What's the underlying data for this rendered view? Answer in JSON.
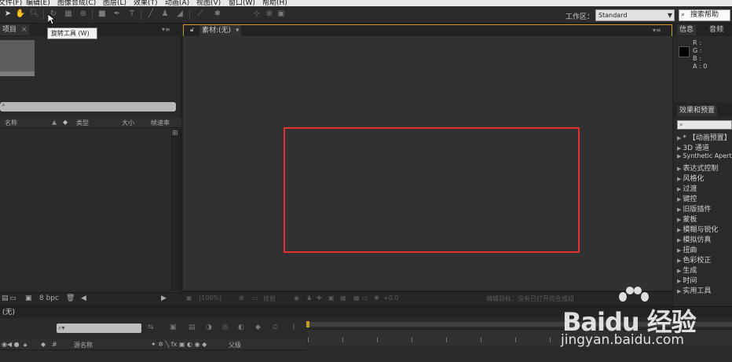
{
  "menubar": {
    "items": [
      "文件(F)",
      "编辑(E)",
      "图像合成(C)",
      "图层(L)",
      "效果(T)",
      "动画(A)",
      "视图(V)",
      "窗口(W)",
      "帮助(H)"
    ]
  },
  "toolbar": {
    "tools": [
      "selection-tool",
      "hand-tool",
      "zoom-tool",
      "rotation-tool",
      "camera-tool",
      "pan-behind-tool",
      "rectangle-tool",
      "pen-tool",
      "type-tool",
      "brush-tool",
      "clone-stamp-tool",
      "eraser-tool",
      "roto-brush-tool",
      "puppet-tool",
      "axis-tool"
    ],
    "workspace_label": "工作区：",
    "workspace_value": "Standard",
    "help_search_placeholder": "搜索帮助"
  },
  "tooltip": {
    "text": "旋转工具 (W)"
  },
  "project_panel": {
    "tab_label": "项目",
    "columns": [
      "名称",
      "类型",
      "大小",
      "帧速率"
    ],
    "footer_bpc": "8 bpc"
  },
  "viewer_panel": {
    "tab_label": "素材:(无)",
    "footer_zoom": "(100%)",
    "footer_text": "编辑目标：没有已打开的合成组",
    "footer_offset": "+0.0",
    "footer_res": "修剪"
  },
  "info_panel": {
    "tabs": [
      "信息",
      "音频"
    ],
    "lines": [
      "R :",
      "G :",
      "B :",
      "A : 0"
    ]
  },
  "effects_panel": {
    "tab_label": "效果和预置",
    "search_placeholder": "",
    "items": [
      "* 【动画预置】",
      "3D 通道",
      "Synthetic Aperture",
      "表达式控制",
      "风格化",
      "过渡",
      "键控",
      "旧版插件",
      "蒙板",
      "模糊与锐化",
      "模拟仿真",
      "扭曲",
      "色彩校正",
      "生成",
      "时间",
      "实用工具"
    ]
  },
  "timeline": {
    "tab_label": "(无)",
    "columns": [
      "源名称",
      "父级"
    ],
    "search_placeholder": ""
  },
  "watermark": {
    "text": "Baidu 经验",
    "url": "jingyan.baidu.com"
  },
  "colors": {
    "panel_bg": "#2a2a2a",
    "active_border": "#c99a2a",
    "highlight_box": "#e0302e"
  }
}
